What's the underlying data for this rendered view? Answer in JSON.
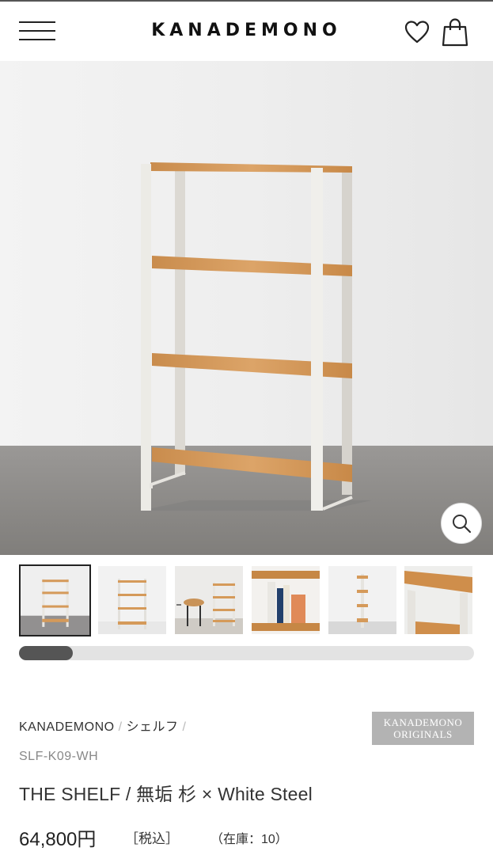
{
  "header": {
    "logo_text": "KANADEMONO",
    "menu_icon": "hamburger-menu-icon",
    "favorite_icon": "heart-icon",
    "cart_icon": "shopping-bag-icon"
  },
  "gallery": {
    "zoom_icon": "magnifier-icon",
    "thumbnails": [
      {
        "name": "thumbnail-1",
        "active": true
      },
      {
        "name": "thumbnail-2",
        "active": false
      },
      {
        "name": "thumbnail-3",
        "active": false
      },
      {
        "name": "thumbnail-4",
        "active": false
      },
      {
        "name": "thumbnail-5",
        "active": false
      },
      {
        "name": "thumbnail-6",
        "active": false
      }
    ]
  },
  "product": {
    "breadcrumb": [
      "KANADEMONO",
      "シェルフ"
    ],
    "badge_line1": "KANADEMONO",
    "badge_line2": "ORIGINALS",
    "sku": "SLF-K09-WH",
    "title": "THE SHELF / 無垢 杉 × White Steel",
    "price": "64,800円",
    "tax_label": "［税込］",
    "stock_text": "（在庫：10）"
  },
  "colors": {
    "wall": "#efefef",
    "floor": "#8b8986",
    "steel": "#e9e7e2",
    "wood": "#d59a5a"
  }
}
